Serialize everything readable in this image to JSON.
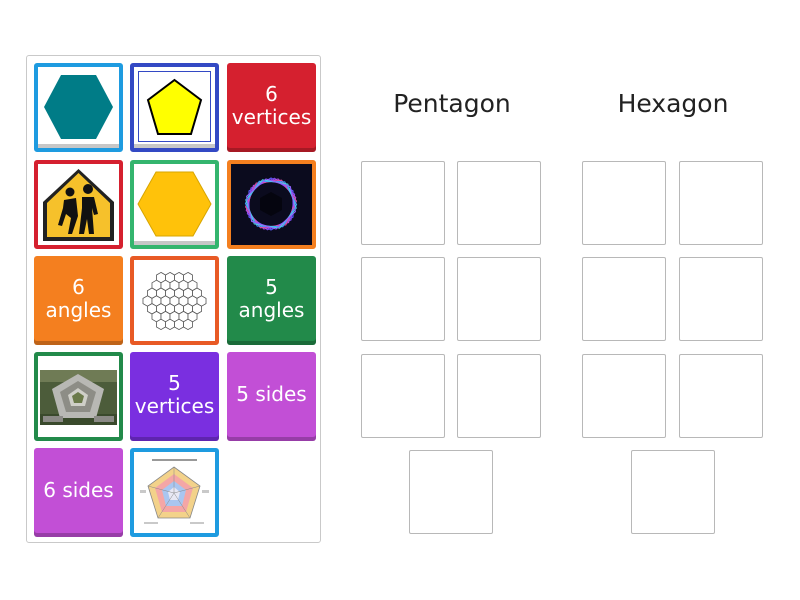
{
  "tiles": {
    "hexagon_teal": {
      "colors": {
        "border": "#1e9be0",
        "fill": "#007c87"
      }
    },
    "pentagon_yellow": {
      "colors": {
        "border": "#3349c4",
        "fill": "#ffff00"
      }
    },
    "six_vertices": {
      "label": "6\nvertices",
      "color": "#d5202f"
    },
    "school_sign": {
      "colors": {
        "border": "#d5202f",
        "sign": "#f6c12b"
      }
    },
    "hexagon_yellow": {
      "colors": {
        "border": "#34b56e",
        "fill": "#ffc20a"
      }
    },
    "neon_hexagon": {
      "colors": {
        "border": "#f47f1f",
        "bg": "#0b0b1e"
      }
    },
    "six_angles": {
      "label": "6\nangles",
      "color": "#f47f1f"
    },
    "honeycomb": {
      "colors": {
        "border": "#e85a25"
      }
    },
    "five_angles": {
      "label": "5\nangles",
      "color": "#228a4a"
    },
    "pentagon_building": {
      "colors": {
        "border": "#228a4a"
      }
    },
    "five_vertices": {
      "label": "5\nvertices",
      "color": "#7a2fe0"
    },
    "five_sides": {
      "label": "5 sides",
      "color": "#c24fd6"
    },
    "six_sides": {
      "label": "6 sides",
      "color": "#c24fd6"
    },
    "pentagon_chart": {
      "colors": {
        "border": "#1e9be0"
      }
    }
  },
  "columns": {
    "pentagon": {
      "title": "Pentagon"
    },
    "hexagon": {
      "title": "Hexagon"
    }
  }
}
